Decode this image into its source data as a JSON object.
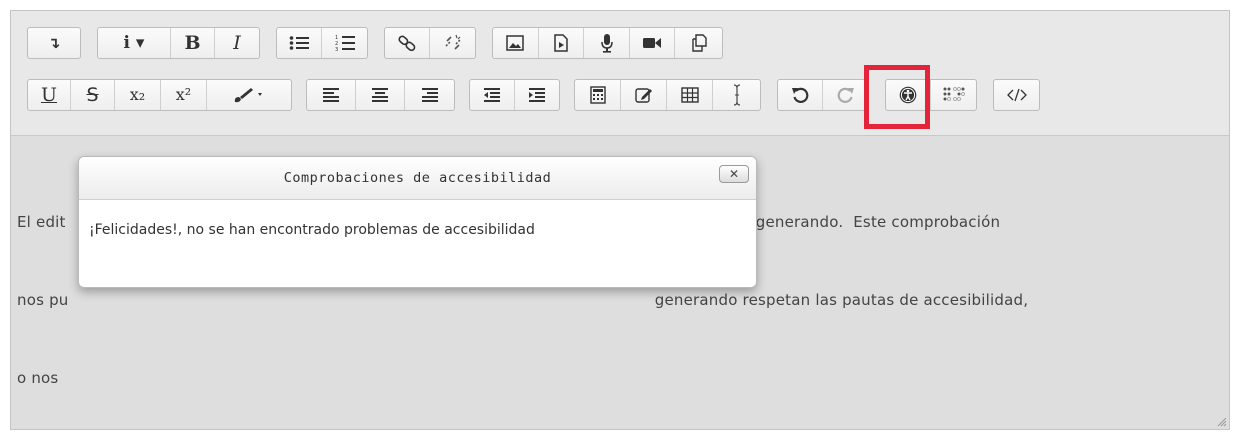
{
  "toolbar": {
    "row1": {
      "collapse": {
        "icon": "collapse-icon",
        "label": "↴"
      },
      "info": {
        "icon": "info-icon",
        "label": "i ▾"
      },
      "bold": {
        "label": "B"
      },
      "italic": {
        "label": "I"
      }
    },
    "row2": {
      "underline": {
        "label": "U"
      },
      "strike": {
        "label": "S"
      },
      "subscript": {
        "label": "x₂"
      },
      "superscript": {
        "label": "x²"
      }
    },
    "highlight_color": "#e3243b"
  },
  "content": {
    "line1": "El edit                                                                                                                      que estamos generando.  Este comprobación",
    "line2": "nos pu                                                                                                                      generando respetan las pautas de accesibilidad,",
    "line3": "o nos "
  },
  "dialog": {
    "title": "Comprobaciones de accesibilidad",
    "close_label": "✕",
    "message": "¡Felicidades!, no se han encontrado problemas de accesibilidad"
  }
}
